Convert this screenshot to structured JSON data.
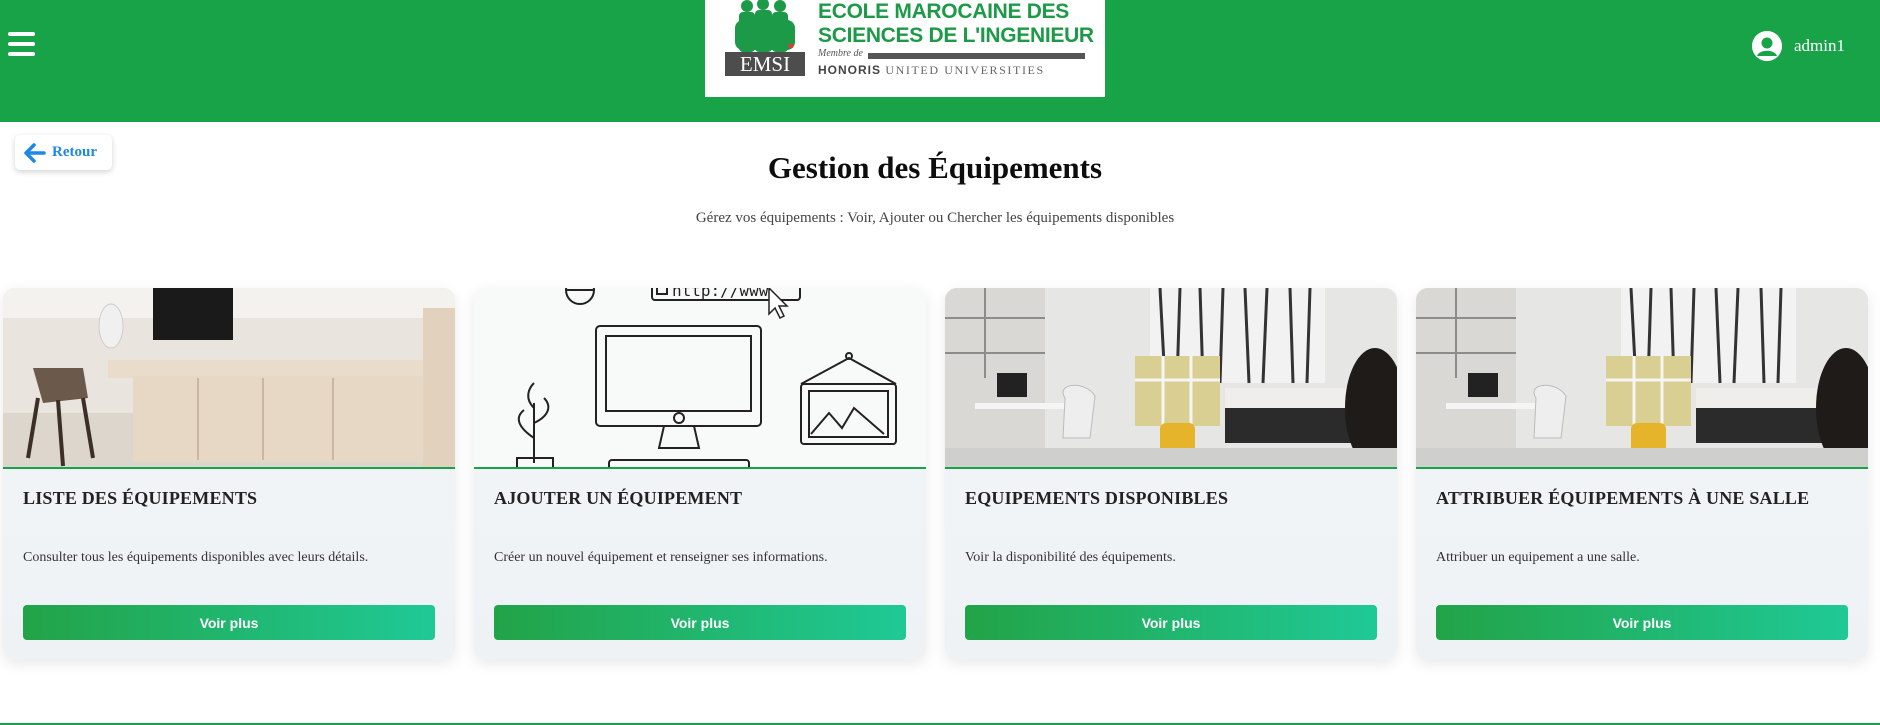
{
  "header": {
    "logo": {
      "line1": "ECOLE MAROCAINE DES",
      "line2": "SCIENCES DE L'INGENIEUR",
      "member_text": "Membre de",
      "honoris": "HONORIS",
      "united": "UNITED UNIVERSITIES",
      "badge": "EMSI"
    },
    "username": "admin1",
    "colors": {
      "brand": "#18a349",
      "accent": "#1e88e5"
    }
  },
  "back": {
    "label": "Retour",
    "icon": "arrow-left-icon"
  },
  "page": {
    "title": "Gestion des Équipements",
    "subtitle": "Gérez vos équipements : Voir, Ajouter ou Chercher les équipements disponibles"
  },
  "cards": [
    {
      "title": "LISTE DES ÉQUIPEMENTS",
      "description": "Consulter tous les équipements disponibles avec leurs détails.",
      "button": "Voir plus",
      "image": "office-desk-photo"
    },
    {
      "title": "AJOUTER UN ÉQUIPEMENT",
      "description": "Créer un nouvel équipement et renseigner ses informations.",
      "button": "Voir plus",
      "image": "computer-illustration",
      "image_text": "http://www."
    },
    {
      "title": "EQUIPEMENTS DISPONIBLES",
      "description": "Voir la disponibilité des équipements.",
      "button": "Voir plus",
      "image": "bedroom-photo"
    },
    {
      "title": "ATTRIBUER ÉQUIPEMENTS À UNE SALLE",
      "description": "Attribuer un equipement a une salle.",
      "button": "Voir plus",
      "image": "bedroom-photo"
    }
  ]
}
